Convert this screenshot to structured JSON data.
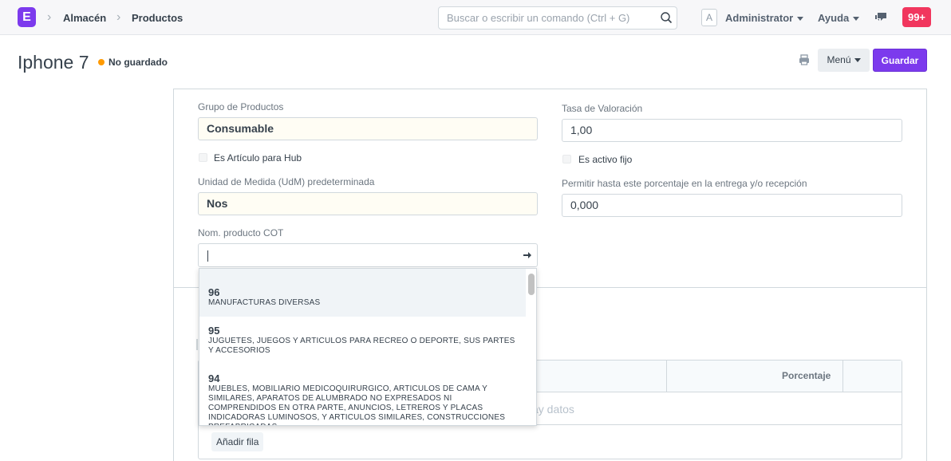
{
  "navbar": {
    "logo_letter": "E",
    "breadcrumbs": [
      "Almacén",
      "Productos"
    ],
    "search_placeholder": "Buscar o escribir un comando (Ctrl + G)",
    "avatar_letter": "A",
    "user_label": "Administrator",
    "help_label": "Ayuda",
    "notification_count": "99+"
  },
  "page": {
    "title": "Iphone 7",
    "status": "No guardado",
    "menu_label": "Menú",
    "save_label": "Guardar"
  },
  "form": {
    "product_group": {
      "label": "Grupo de Productos",
      "value": "Consumable"
    },
    "is_hub_item": {
      "label": "Es Artículo para Hub",
      "checked": false
    },
    "default_uom": {
      "label": "Unidad de Medida (UdM) predeterminada",
      "value": "Nos"
    },
    "cot_product_name": {
      "label": "Nom. producto COT",
      "value": ""
    },
    "valuation_rate": {
      "label": "Tasa de Valoración",
      "value": "1,00"
    },
    "is_fixed_asset": {
      "label": "Es activo fijo",
      "checked": false
    },
    "allowance_percent": {
      "label": "Permitir hasta este porcentaje en la entrega y/o recepción",
      "value": "0,000"
    }
  },
  "dropdown": {
    "items": [
      {
        "code": "96",
        "description": "MANUFACTURAS DIVERSAS"
      },
      {
        "code": "95",
        "description": "JUGUETES, JUEGOS Y ARTICULOS PARA RECREO O DEPORTE, SUS PARTES Y ACCESORIOS"
      },
      {
        "code": "94",
        "description": "MUEBLES, MOBILIARIO MEDICOQUIRURGICO, ARTICULOS DE CAMA Y SIMILARES, APARATOS DE ALUMBRADO NO EXPRESADOS NI COMPRENDIDOS EN OTRA PARTE, ANUNCIOS, LETREROS Y PLACAS INDICADORAS LUMINOSOS, Y ARTICULOS SIMILARES, CONSTRUCCIONES PREFABRICADAS"
      }
    ]
  },
  "table": {
    "header_percentage": "Porcentaje",
    "empty_text": "ay datos",
    "add_row_label": "Añadir fila"
  },
  "colors": {
    "brand": "#7c3aed",
    "notification": "#f1365e",
    "unsaved_dot": "#ff9a00"
  }
}
